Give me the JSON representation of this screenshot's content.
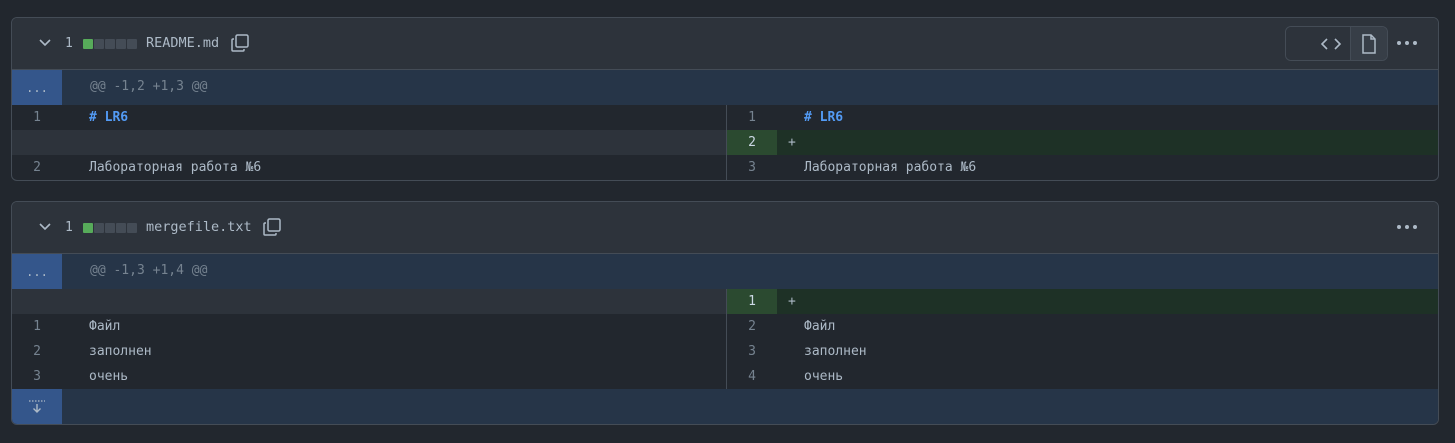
{
  "colors": {
    "background": "#22272e",
    "header": "#2d333b",
    "border": "#444c56",
    "hunk": "#263548",
    "expander": "#34568b",
    "addition_gutter": "#2b4a30",
    "addition_line": "#1e3126",
    "diffstat_added": "#57ab5a",
    "heading_text": "#539bf5"
  },
  "files": [
    {
      "changes": "1",
      "diffstat": [
        "added",
        "neutral",
        "neutral",
        "neutral",
        "neutral"
      ],
      "filename": "README.md",
      "hunk_header": "@@ -1,2 +1,3 @@",
      "expander_label": "...",
      "rows": [
        {
          "left_ln": "1",
          "left_code": "# LR6",
          "right_ln": "1",
          "right_code": "# LR6"
        },
        {
          "left_ln": "",
          "left_code": "",
          "right_ln": "2",
          "right_code": "+"
        },
        {
          "left_ln": "2",
          "left_code": "Лабораторная работа №6",
          "right_ln": "3",
          "right_code": "Лабораторная работа №6"
        }
      ]
    },
    {
      "changes": "1",
      "diffstat": [
        "added",
        "neutral",
        "neutral",
        "neutral",
        "neutral"
      ],
      "filename": "mergefile.txt",
      "hunk_header": "@@ -1,3 +1,4 @@",
      "expander_label": "...",
      "rows": [
        {
          "left_ln": "",
          "left_code": "",
          "right_ln": "1",
          "right_code": "+"
        },
        {
          "left_ln": "1",
          "left_code": "Файл",
          "right_ln": "2",
          "right_code": "Файл"
        },
        {
          "left_ln": "2",
          "left_code": "заполнен",
          "right_ln": "3",
          "right_code": "заполнен"
        },
        {
          "left_ln": "3",
          "left_code": "очень",
          "right_ln": "4",
          "right_code": "очень"
        }
      ]
    }
  ]
}
